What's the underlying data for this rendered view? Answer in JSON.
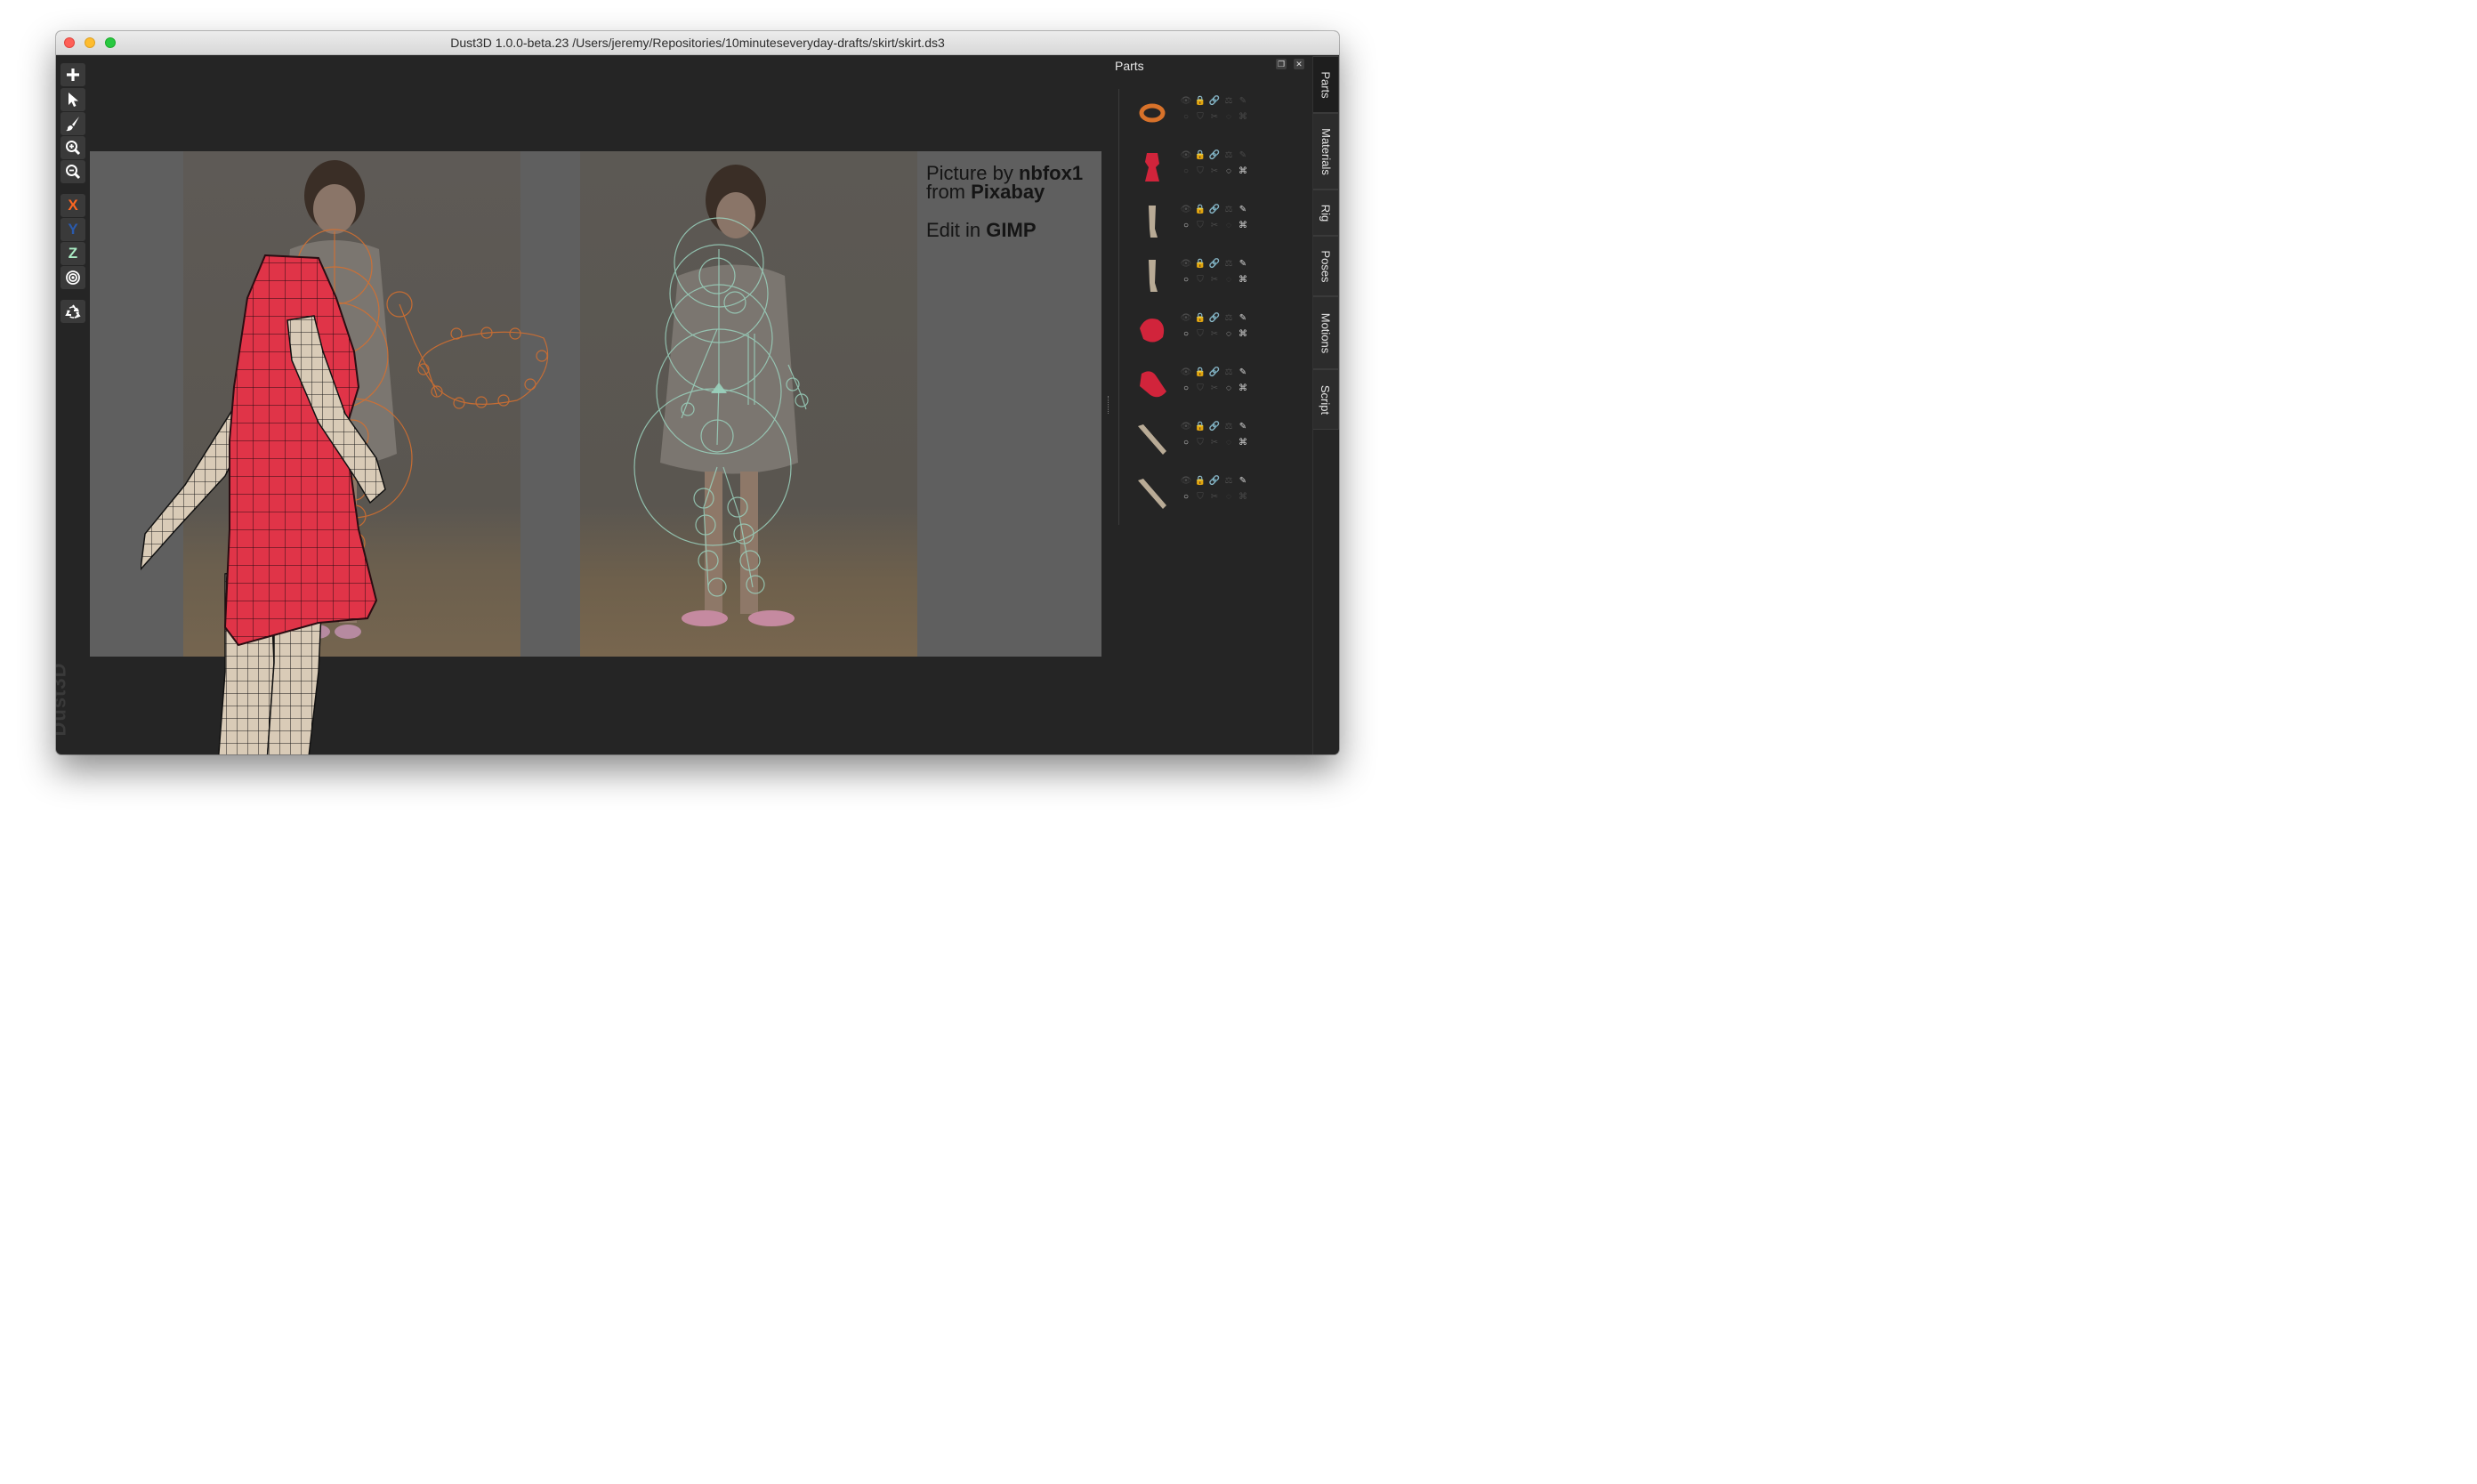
{
  "window": {
    "title": "Dust3D 1.0.0-beta.23 /Users/jeremy/Repositories/10minuteseveryday-drafts/skirt/skirt.ds3"
  },
  "toolbar": {
    "buttons": [
      {
        "name": "add",
        "icon": "plus-icon"
      },
      {
        "name": "select",
        "icon": "pointer-icon"
      },
      {
        "name": "paint",
        "icon": "brush-icon"
      },
      {
        "name": "zoom-in",
        "icon": "zoom-in-icon"
      },
      {
        "name": "zoom-out",
        "icon": "zoom-out-icon"
      }
    ],
    "axis": {
      "x": "X",
      "y": "Y",
      "z": "Z"
    },
    "radial_icon": "target-icon",
    "regenerate_icon": "recycle-icon",
    "brand": "Dust3D"
  },
  "canvas": {
    "credit_prefix": "Picture by",
    "credit_author": "nbfox1",
    "credit_from": "from",
    "credit_site": "Pixabay",
    "edit_prefix": "Edit in",
    "edit_app": "GIMP"
  },
  "parts_panel": {
    "title": "Parts",
    "float_icon": "float-window-icon",
    "close_icon": "close-icon",
    "parts": [
      {
        "thumb_color": "#d8722a",
        "shape": "ring"
      },
      {
        "thumb_color": "#d1243b",
        "shape": "torso"
      },
      {
        "thumb_color": "#b9ab96",
        "shape": "leg"
      },
      {
        "thumb_color": "#b9ab96",
        "shape": "leg"
      },
      {
        "thumb_color": "#d1243b",
        "shape": "blob"
      },
      {
        "thumb_color": "#d1243b",
        "shape": "skirt"
      },
      {
        "thumb_color": "#b9ab96",
        "shape": "arm"
      },
      {
        "thumb_color": "#b9ab96",
        "shape": "arm"
      }
    ]
  },
  "tabs": [
    "Parts",
    "Materials",
    "Rig",
    "Poses",
    "Motions",
    "Script"
  ],
  "colors": {
    "background": "#252525",
    "toolbar_button": "#3a3a3a",
    "axis_x": "#fc6621",
    "axis_y": "#2a5aac",
    "axis_z": "#aaebc4",
    "dress": "#e03448",
    "skin": "#d9cbb7",
    "left_skeleton": "#d8702e",
    "right_skeleton": "#9ad1bd"
  }
}
